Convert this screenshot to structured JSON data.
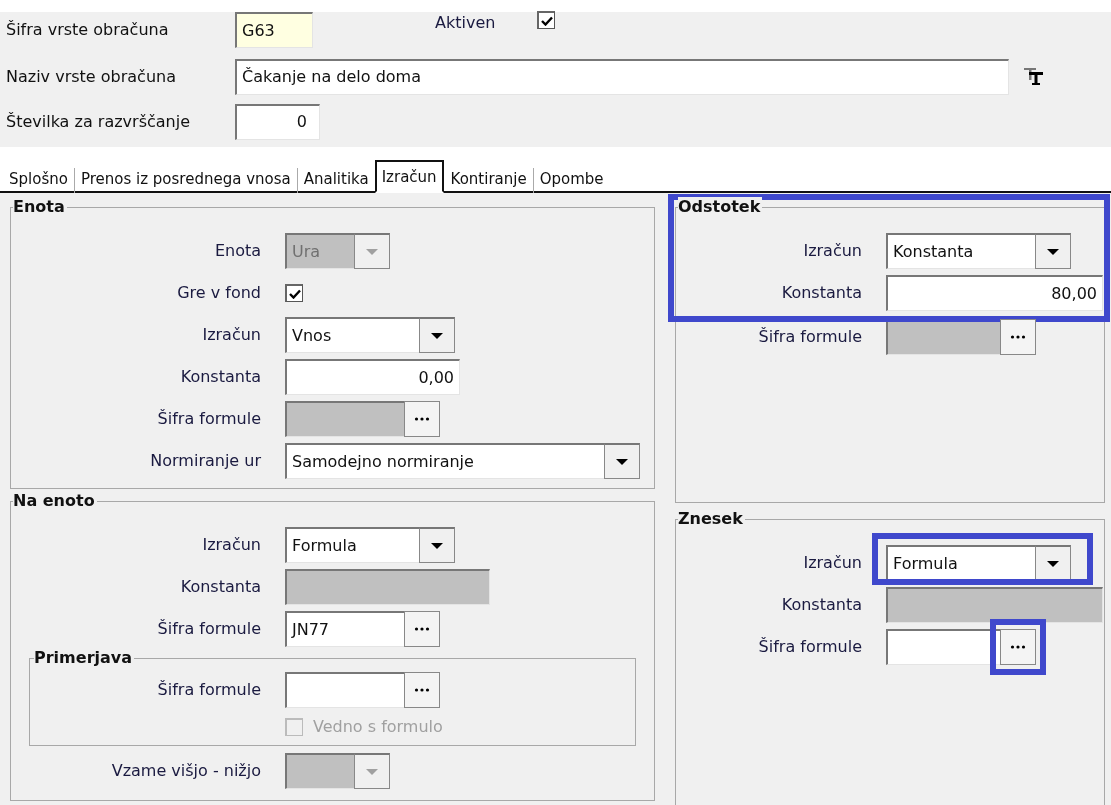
{
  "header": {
    "code": {
      "label": "Šifra vrste obračuna",
      "value": "G63"
    },
    "active": {
      "label": "Aktiven",
      "checked": true
    },
    "name": {
      "label": "Naziv vrste obračuna",
      "value": "Čakanje na delo doma"
    },
    "sort": {
      "label": "Številka  za razvrščanje",
      "value": "0"
    }
  },
  "tabs": [
    {
      "label": "Splošno",
      "selected": false
    },
    {
      "label": "Prenos iz posrednega vnosa",
      "selected": false
    },
    {
      "label": "Analitika",
      "selected": false
    },
    {
      "label": "Izračun",
      "selected": true
    },
    {
      "label": "Kontiranje",
      "selected": false
    },
    {
      "label": "Opombe",
      "selected": false
    }
  ],
  "columns": [
    [
      {
        "title": "Enota",
        "items": [
          {
            "kind": "combo",
            "label": "Enota",
            "value": "Ura",
            "disabled": true
          },
          {
            "kind": "checkbox",
            "label": "Gre v fond",
            "checked": true,
            "disabled": false
          },
          {
            "kind": "combo",
            "label": "Izračun",
            "value": "Vnos",
            "disabled": false
          },
          {
            "kind": "number",
            "label": "Konstanta",
            "value": "0,00",
            "disabled": false
          },
          {
            "kind": "lookup",
            "label": "Šifra formule",
            "disabled": true
          },
          {
            "kind": "combo",
            "label": "Normiranje ur",
            "value": "Samodejno normiranje",
            "disabled": false,
            "wide": true
          }
        ]
      },
      {
        "title": "Na enoto",
        "items": [
          {
            "kind": "combo",
            "label": "Izračun",
            "value": "Formula",
            "disabled": false
          },
          {
            "kind": "number",
            "label": "Konstanta",
            "disabled": true
          },
          {
            "kind": "lookup",
            "label": "Šifra formule",
            "value": "JN77",
            "disabled": false
          },
          {
            "kind": "group",
            "title": "Primerjava",
            "items": [
              {
                "kind": "lookup",
                "label": "Šifra formule",
                "disabled": false
              },
              {
                "kind": "checkbox",
                "caption": "Vedno s formulo",
                "checked": false,
                "disabled": true
              }
            ]
          },
          {
            "kind": "combo",
            "label": "Vzame višjo - nižjo",
            "disabled": true
          }
        ]
      }
    ],
    [
      {
        "title": "Odstotek",
        "items": [
          {
            "kind": "combo",
            "label": "Izračun",
            "value": "Konstanta",
            "disabled": false,
            "framed": true
          },
          {
            "kind": "number",
            "label": "Konstanta",
            "value": "80,00",
            "disabled": false,
            "framed": true
          },
          {
            "kind": "lookup",
            "label": "Šifra formule",
            "disabled": true
          }
        ]
      },
      {
        "title": "Znesek",
        "items": [
          {
            "kind": "combo",
            "label": "Izračun",
            "value": "Formula",
            "disabled": false,
            "highlighted": true
          },
          {
            "kind": "number",
            "label": "Konstanta",
            "disabled": true
          },
          {
            "kind": "lookup",
            "label": "Šifra formule",
            "disabled": false,
            "button_highlighted": true
          }
        ]
      }
    ]
  ]
}
